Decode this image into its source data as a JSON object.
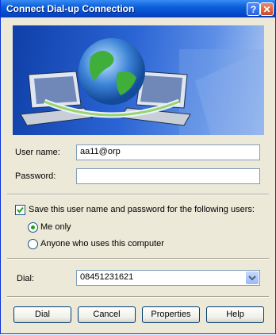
{
  "window": {
    "title": "Connect Dial-up Connection",
    "help_glyph": "?",
    "close_glyph": "✕"
  },
  "icons": [
    "network-globe-icon",
    "laptop-icon",
    "help-icon",
    "close-icon",
    "chevron-down-icon",
    "checkmark-icon"
  ],
  "form": {
    "username_label": "User name:",
    "username_value": "aa11@orp",
    "password_label": "Password:",
    "password_value": "",
    "save_label": "Save this user name and password for the following users:",
    "save_checked": true,
    "radio_me_only": "Me only",
    "radio_anyone": "Anyone who uses this computer",
    "selected_radio": "Me only",
    "dial_label": "Dial:",
    "dial_value": "08451231621"
  },
  "buttons": {
    "dial": "Dial",
    "cancel": "Cancel",
    "properties": "Properties",
    "help": "Help"
  },
  "colors": {
    "titlebar": "#0546c8",
    "dialog_bg": "#ece9d8",
    "accent": "#21a121"
  }
}
